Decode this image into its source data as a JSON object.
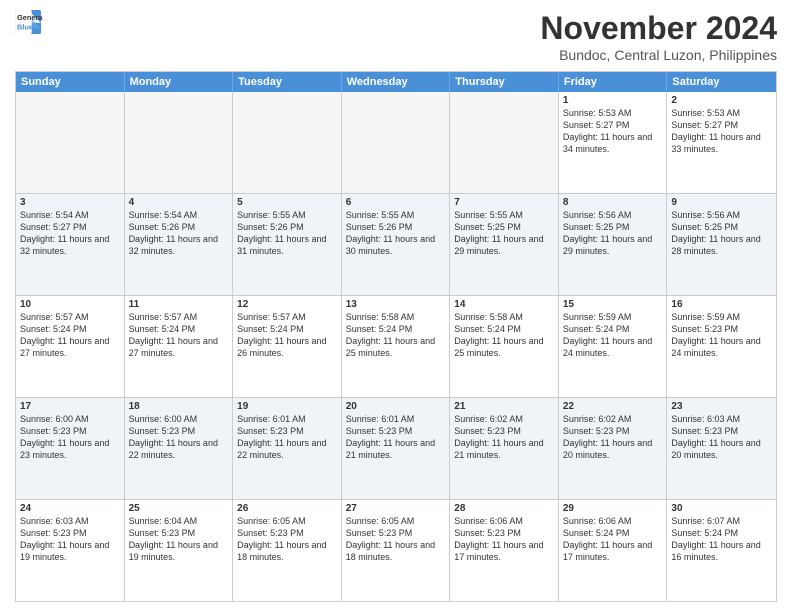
{
  "logo": {
    "line1": "General",
    "line2": "Blue"
  },
  "title": "November 2024",
  "subtitle": "Bundoc, Central Luzon, Philippines",
  "headers": [
    "Sunday",
    "Monday",
    "Tuesday",
    "Wednesday",
    "Thursday",
    "Friday",
    "Saturday"
  ],
  "rows": [
    [
      {
        "day": "",
        "info": ""
      },
      {
        "day": "",
        "info": ""
      },
      {
        "day": "",
        "info": ""
      },
      {
        "day": "",
        "info": ""
      },
      {
        "day": "",
        "info": ""
      },
      {
        "day": "1",
        "info": "Sunrise: 5:53 AM\nSunset: 5:27 PM\nDaylight: 11 hours and 34 minutes."
      },
      {
        "day": "2",
        "info": "Sunrise: 5:53 AM\nSunset: 5:27 PM\nDaylight: 11 hours and 33 minutes."
      }
    ],
    [
      {
        "day": "3",
        "info": "Sunrise: 5:54 AM\nSunset: 5:27 PM\nDaylight: 11 hours and 32 minutes."
      },
      {
        "day": "4",
        "info": "Sunrise: 5:54 AM\nSunset: 5:26 PM\nDaylight: 11 hours and 32 minutes."
      },
      {
        "day": "5",
        "info": "Sunrise: 5:55 AM\nSunset: 5:26 PM\nDaylight: 11 hours and 31 minutes."
      },
      {
        "day": "6",
        "info": "Sunrise: 5:55 AM\nSunset: 5:26 PM\nDaylight: 11 hours and 30 minutes."
      },
      {
        "day": "7",
        "info": "Sunrise: 5:55 AM\nSunset: 5:25 PM\nDaylight: 11 hours and 29 minutes."
      },
      {
        "day": "8",
        "info": "Sunrise: 5:56 AM\nSunset: 5:25 PM\nDaylight: 11 hours and 29 minutes."
      },
      {
        "day": "9",
        "info": "Sunrise: 5:56 AM\nSunset: 5:25 PM\nDaylight: 11 hours and 28 minutes."
      }
    ],
    [
      {
        "day": "10",
        "info": "Sunrise: 5:57 AM\nSunset: 5:24 PM\nDaylight: 11 hours and 27 minutes."
      },
      {
        "day": "11",
        "info": "Sunrise: 5:57 AM\nSunset: 5:24 PM\nDaylight: 11 hours and 27 minutes."
      },
      {
        "day": "12",
        "info": "Sunrise: 5:57 AM\nSunset: 5:24 PM\nDaylight: 11 hours and 26 minutes."
      },
      {
        "day": "13",
        "info": "Sunrise: 5:58 AM\nSunset: 5:24 PM\nDaylight: 11 hours and 25 minutes."
      },
      {
        "day": "14",
        "info": "Sunrise: 5:58 AM\nSunset: 5:24 PM\nDaylight: 11 hours and 25 minutes."
      },
      {
        "day": "15",
        "info": "Sunrise: 5:59 AM\nSunset: 5:24 PM\nDaylight: 11 hours and 24 minutes."
      },
      {
        "day": "16",
        "info": "Sunrise: 5:59 AM\nSunset: 5:23 PM\nDaylight: 11 hours and 24 minutes."
      }
    ],
    [
      {
        "day": "17",
        "info": "Sunrise: 6:00 AM\nSunset: 5:23 PM\nDaylight: 11 hours and 23 minutes."
      },
      {
        "day": "18",
        "info": "Sunrise: 6:00 AM\nSunset: 5:23 PM\nDaylight: 11 hours and 22 minutes."
      },
      {
        "day": "19",
        "info": "Sunrise: 6:01 AM\nSunset: 5:23 PM\nDaylight: 11 hours and 22 minutes."
      },
      {
        "day": "20",
        "info": "Sunrise: 6:01 AM\nSunset: 5:23 PM\nDaylight: 11 hours and 21 minutes."
      },
      {
        "day": "21",
        "info": "Sunrise: 6:02 AM\nSunset: 5:23 PM\nDaylight: 11 hours and 21 minutes."
      },
      {
        "day": "22",
        "info": "Sunrise: 6:02 AM\nSunset: 5:23 PM\nDaylight: 11 hours and 20 minutes."
      },
      {
        "day": "23",
        "info": "Sunrise: 6:03 AM\nSunset: 5:23 PM\nDaylight: 11 hours and 20 minutes."
      }
    ],
    [
      {
        "day": "24",
        "info": "Sunrise: 6:03 AM\nSunset: 5:23 PM\nDaylight: 11 hours and 19 minutes."
      },
      {
        "day": "25",
        "info": "Sunrise: 6:04 AM\nSunset: 5:23 PM\nDaylight: 11 hours and 19 minutes."
      },
      {
        "day": "26",
        "info": "Sunrise: 6:05 AM\nSunset: 5:23 PM\nDaylight: 11 hours and 18 minutes."
      },
      {
        "day": "27",
        "info": "Sunrise: 6:05 AM\nSunset: 5:23 PM\nDaylight: 11 hours and 18 minutes."
      },
      {
        "day": "28",
        "info": "Sunrise: 6:06 AM\nSunset: 5:23 PM\nDaylight: 11 hours and 17 minutes."
      },
      {
        "day": "29",
        "info": "Sunrise: 6:06 AM\nSunset: 5:24 PM\nDaylight: 11 hours and 17 minutes."
      },
      {
        "day": "30",
        "info": "Sunrise: 6:07 AM\nSunset: 5:24 PM\nDaylight: 11 hours and 16 minutes."
      }
    ]
  ]
}
